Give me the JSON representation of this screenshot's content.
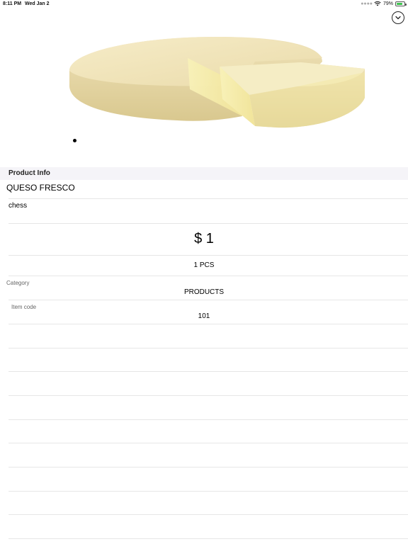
{
  "status_bar": {
    "time": "8:11 PM",
    "date": "Wed Jan 2",
    "battery_percent": "79%",
    "battery_level": 0.79,
    "battery_color": "#3cc24d"
  },
  "section": {
    "header": "Product Info"
  },
  "product": {
    "name": "QUESO FRESCO",
    "description": "chess",
    "price": "$ 1",
    "quantity": "1  PCS",
    "category_label": "Category",
    "category_value": "PRODUCTS",
    "item_code_label": "Item code",
    "item_code_value": "101"
  },
  "icons": {
    "collapse": "chevron-down-circle-icon",
    "image": "cheese-wheel-image"
  },
  "colors": {
    "section_header_bg": "#f5f4f8",
    "divider": "#e6e6e6"
  }
}
